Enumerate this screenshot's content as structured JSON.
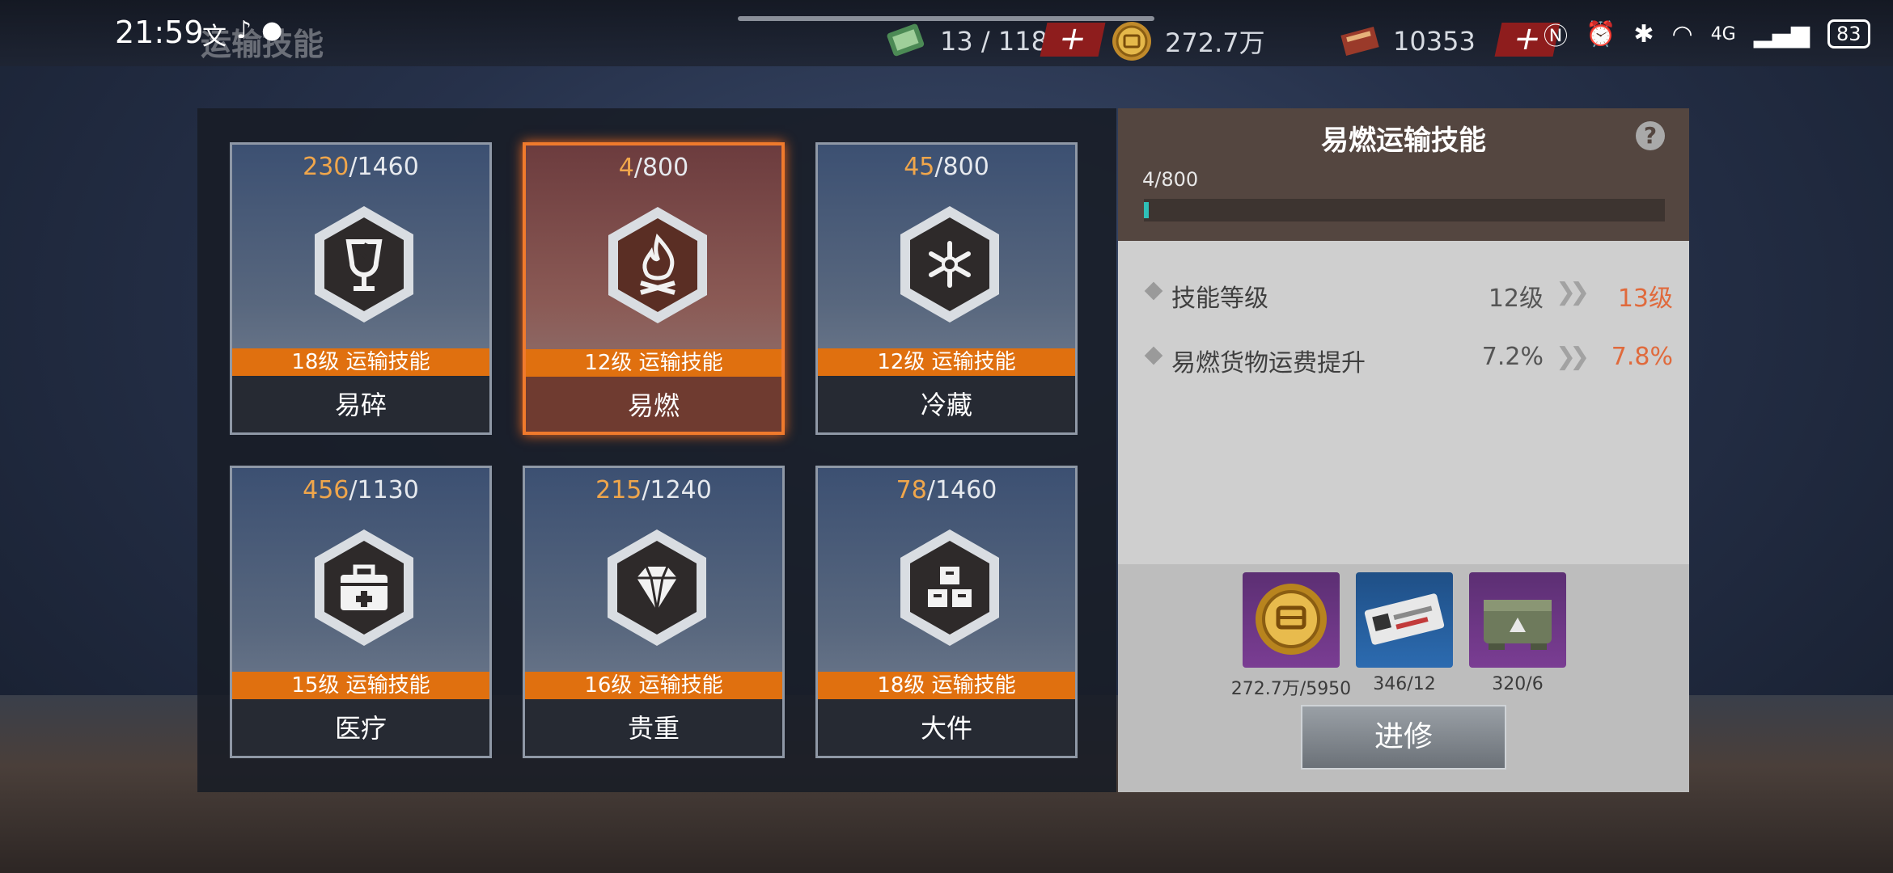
{
  "status_bar": {
    "time": "21:59",
    "battery": "83",
    "net_label": "4G"
  },
  "topbar": {
    "title": "运输技能"
  },
  "resources": [
    {
      "icon": "ticket-icon",
      "value": "13 / 118"
    },
    {
      "icon": "gold-coin-icon",
      "value": "272.7万"
    },
    {
      "icon": "crate-icon",
      "value": "10353"
    }
  ],
  "skills": [
    {
      "current": "230",
      "max": "/1460",
      "level": "18级 运输技能",
      "name": "易碎",
      "icon": "fragile-glass-icon"
    },
    {
      "current": "4",
      "max": "/800",
      "level": "12级 运输技能",
      "name": "易燃",
      "icon": "flame-icon"
    },
    {
      "current": "45",
      "max": "/800",
      "level": "12级 运输技能",
      "name": "冷藏",
      "icon": "snowflake-icon"
    },
    {
      "current": "456",
      "max": "/1130",
      "level": "15级 运输技能",
      "name": "医疗",
      "icon": "medical-kit-icon"
    },
    {
      "current": "215",
      "max": "/1240",
      "level": "16级 运输技能",
      "name": "贵重",
      "icon": "diamond-icon"
    },
    {
      "current": "78",
      "max": "/1460",
      "level": "18级 运输技能",
      "name": "大件",
      "icon": "boxes-icon"
    }
  ],
  "selected_index": 1,
  "detail": {
    "title": "易燃运输技能",
    "help": "?",
    "progress_text": "4/800",
    "progress_fraction": 0.005,
    "stats": [
      {
        "label": "技能等级",
        "from": "12级",
        "arrow": "❯❯",
        "to": "13级"
      },
      {
        "label": "易燃货物运费提升",
        "from": "7.2%",
        "arrow": "❯❯",
        "to": "7.8%"
      }
    ],
    "materials": [
      {
        "icon": "gold-coin-icon",
        "count": "272.7万/5950"
      },
      {
        "icon": "chip-card-icon",
        "count": "346/12"
      },
      {
        "icon": "supply-box-icon",
        "count": "320/6"
      }
    ],
    "repair_label": "进修"
  }
}
